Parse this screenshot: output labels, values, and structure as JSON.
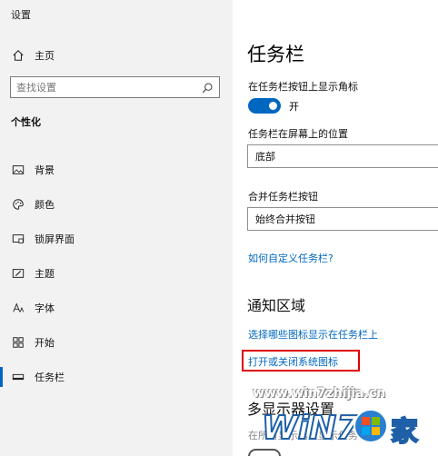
{
  "sidebar": {
    "app_title": "设置",
    "home_label": "主页",
    "search_placeholder": "查找设置",
    "section_title": "个性化",
    "items": [
      {
        "label": "背景",
        "icon": "image-icon"
      },
      {
        "label": "颜色",
        "icon": "palette-icon"
      },
      {
        "label": "锁屏界面",
        "icon": "lock-screen-icon"
      },
      {
        "label": "主题",
        "icon": "theme-brush-icon"
      },
      {
        "label": "字体",
        "icon": "font-icon"
      },
      {
        "label": "开始",
        "icon": "start-grid-icon"
      },
      {
        "label": "任务栏",
        "icon": "taskbar-icon",
        "selected": true
      }
    ]
  },
  "main": {
    "title": "任务栏",
    "badge_setting_label": "在任务栏按钮上显示角标",
    "badge_toggle_state": "开",
    "position_label": "任务栏在屏幕上的位置",
    "position_value": "底部",
    "combine_label": "合并任务栏按钮",
    "combine_value": "始终合并按钮",
    "customize_link": "如何自定义任务栏?",
    "notification_heading": "通知区域",
    "select_icons_link": "选择哪些图标显示在任务栏上",
    "system_icons_link": "打开或关闭系统图标",
    "multi_display_heading": "多显示器设置",
    "multi_display_text": "在所有显示器上显示任务栏"
  },
  "watermark": {
    "url": "www.win7zhijia.cn",
    "logo_text": "WiN7",
    "logo_suffix": "家"
  },
  "colors": {
    "accent": "#0067c0",
    "highlight_box": "#e00000",
    "sidebar_bg": "#f2f2f2"
  }
}
